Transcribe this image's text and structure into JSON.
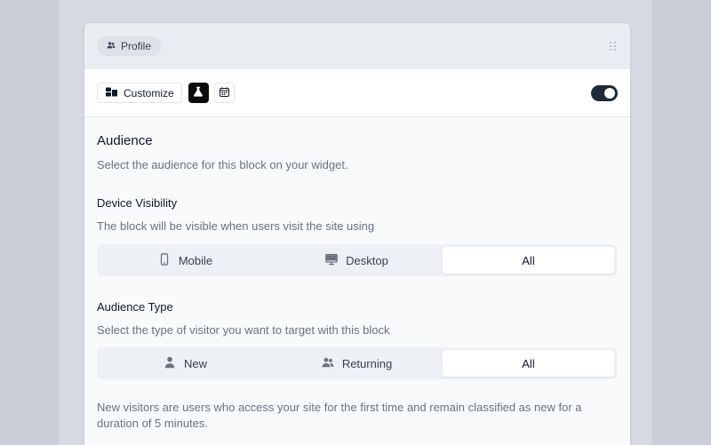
{
  "header": {
    "profile_label": "Profile",
    "profile_icon": "users-icon",
    "drag_icon": "drag-handle-icon"
  },
  "toolbar": {
    "customize_label": "Customize",
    "customize_icon": "layout-icon",
    "lab_icon": "flask-icon",
    "calendar_icon": "calendar-icon",
    "toggle_on": true
  },
  "audience": {
    "title": "Audience",
    "description": "Select the audience for this block on your widget."
  },
  "device": {
    "title": "Device Visibility",
    "description": "The block will be visible when users visit the site using",
    "options": [
      {
        "label": "Mobile",
        "icon": "mobile-icon"
      },
      {
        "label": "Desktop",
        "icon": "monitor-icon"
      },
      {
        "label": "All",
        "icon": ""
      }
    ],
    "selected": "All"
  },
  "audience_type": {
    "title": "Audience Type",
    "description": "Select the type of visitor you want to target with this block",
    "options": [
      {
        "label": "New",
        "icon": "user-icon"
      },
      {
        "label": "Returning",
        "icon": "users-icon"
      },
      {
        "label": "All",
        "icon": ""
      }
    ],
    "selected": "All"
  },
  "note": "New visitors are users who access your site for the first time and remain classified as new for a duration of 5 minutes.",
  "colors": {
    "toggle": "#1e2a3b",
    "active_segment": "#ffffff",
    "segment_bg": "#edf0f4"
  }
}
